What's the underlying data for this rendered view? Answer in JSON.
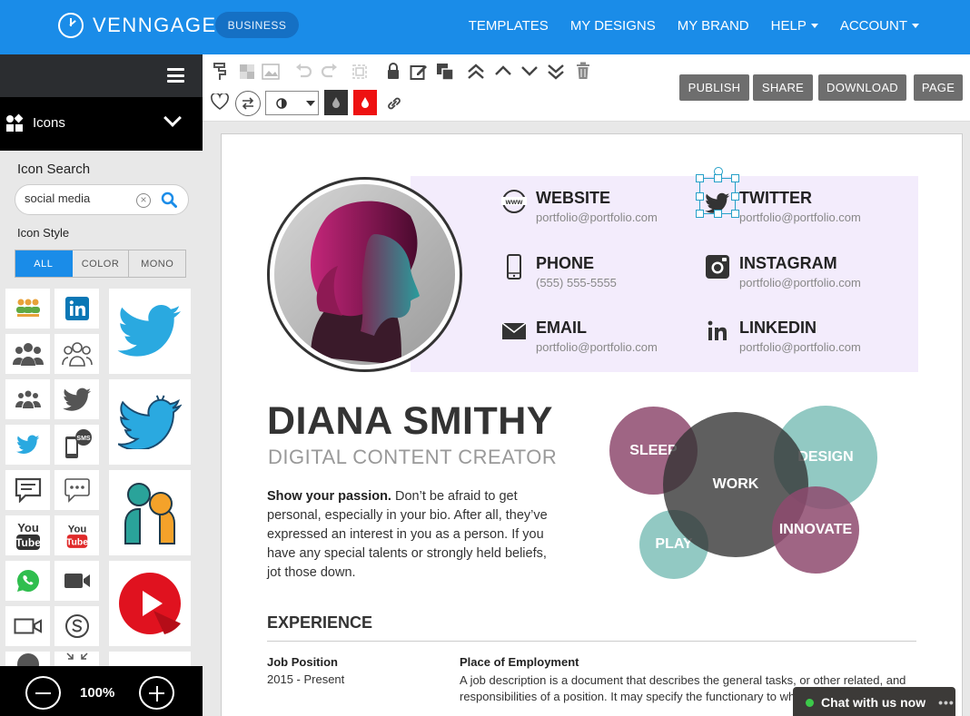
{
  "brand": {
    "name": "VENNGAGE",
    "plan": "BUSINESS"
  },
  "nav": [
    {
      "label": "TEMPLATES",
      "dropdown": false
    },
    {
      "label": "MY DESIGNS",
      "dropdown": false
    },
    {
      "label": "MY BRAND",
      "dropdown": false
    },
    {
      "label": "HELP",
      "dropdown": true
    },
    {
      "label": "ACCOUNT",
      "dropdown": true
    }
  ],
  "sidebar": {
    "panel_title": "Icons",
    "search_label": "Icon Search",
    "search_value": "social media",
    "style_label": "Icon Style",
    "style_tabs": [
      "ALL",
      "COLOR",
      "MONO"
    ],
    "style_active": "ALL",
    "zoom_level": "100%"
  },
  "toolbar": {
    "buttons": [
      "PUBLISH",
      "SHARE",
      "DOWNLOAD",
      "PAGE"
    ],
    "swatch_dark": "#333333",
    "swatch_red": "#ee1111"
  },
  "resume": {
    "name": "DIANA SMITHY",
    "role": "DIGITAL CONTENT CREATOR",
    "bio_lead": "Show your passion.",
    "bio_rest": " Don’t be afraid to get personal, especially in your bio. After all, they’ve expressed an interest in you as a person. If you have any special talents or strongly held beliefs, jot those down.",
    "contacts": [
      {
        "label": "WEBSITE",
        "value": "portfolio@portfolio.com",
        "icon": "www-icon"
      },
      {
        "label": "TWITTER",
        "value": "portfolio@portfolio.com",
        "icon": "twitter-icon"
      },
      {
        "label": "PHONE",
        "value": "(555) 555-5555",
        "icon": "phone-icon"
      },
      {
        "label": "INSTAGRAM",
        "value": "portfolio@portfolio.com",
        "icon": "instagram-icon"
      },
      {
        "label": "EMAIL",
        "value": "portfolio@portfolio.com",
        "icon": "envelope-icon"
      },
      {
        "label": "LINKEDIN",
        "value": "portfolio@portfolio.com",
        "icon": "linkedin-icon"
      }
    ],
    "venn": [
      "SLEEP",
      "WORK",
      "DESIGN",
      "PLAY",
      "INNOVATE"
    ],
    "experience_title": "EXPERIENCE",
    "job_position": "Job Position",
    "job_dates": "2015 - Present",
    "employer": "Place of Employment",
    "job_desc": "A job description is a document that describes the general tasks, or other related, and responsibilities of a position. It may specify the functionary to whom"
  },
  "chat": {
    "label": "Chat with us now",
    "more": "•••"
  },
  "colors": {
    "accent": "#1a8ce8",
    "plum": "#8e4a6e",
    "teal": "#7fbfb8",
    "work": "#3e3e3e",
    "band": "#f3ecfc"
  }
}
